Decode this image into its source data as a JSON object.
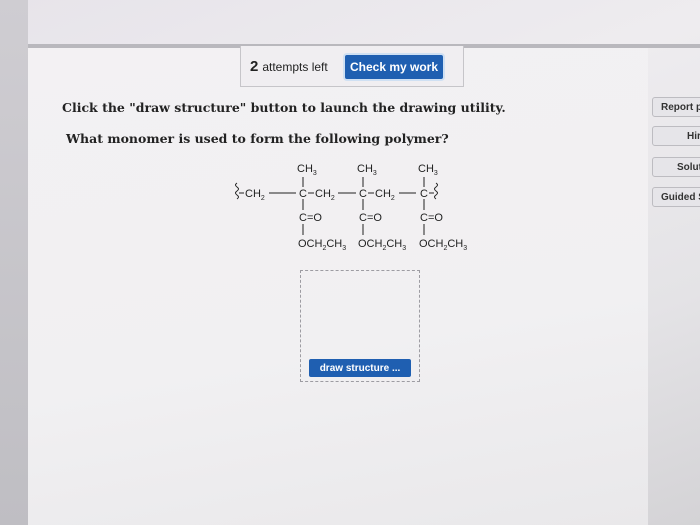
{
  "header": {
    "attempts_count": "2",
    "attempts_label": "attempts left",
    "check_button": "Check my work"
  },
  "side_buttons": [
    "Report p",
    "Hir",
    "Solut",
    "Guided S"
  ],
  "instructions": "Click the \"draw structure\" button to launch the drawing utility.",
  "question": "What monomer is used to form the following polymer?",
  "structure": {
    "methyl": "CH",
    "methyl_sub": "3",
    "backbone_ch": "CH",
    "backbone_sub": "2",
    "carbon": "C",
    "carbonyl": "C=O",
    "ester": "OCH",
    "ester_sub1": "2",
    "ester_mid": "CH",
    "ester_sub2": "3"
  },
  "draw_button": "draw structure ...",
  "colors": {
    "primary_button": "#1f5fb1"
  }
}
